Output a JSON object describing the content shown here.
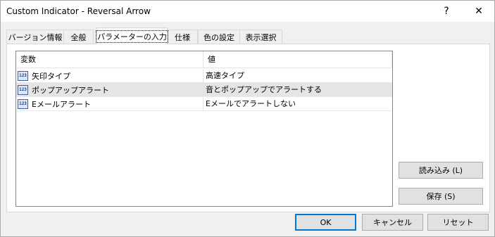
{
  "window": {
    "title": "Custom Indicator - Reversal Arrow",
    "help_label": "?",
    "close_label": "✕"
  },
  "tabs": [
    {
      "label": "バージョン情報"
    },
    {
      "label": "全般"
    },
    {
      "label": "パラメーターの入力"
    },
    {
      "label": "仕様"
    },
    {
      "label": "色の設定"
    },
    {
      "label": "表示選択"
    }
  ],
  "grid": {
    "headers": [
      "変数",
      "値"
    ],
    "icon_text": "123",
    "rows": [
      {
        "name": "矢印タイプ",
        "value": "高速タイプ"
      },
      {
        "name": "ポップアップアラート",
        "value": "音とポップアップでアラートする"
      },
      {
        "name": "Eメールアラート",
        "value": "Eメールでアラートしない"
      }
    ]
  },
  "buttons": {
    "load": "読み込み (L)",
    "save": "保存 (S)",
    "ok": "OK",
    "cancel": "キャンセル",
    "reset": "リセット"
  }
}
